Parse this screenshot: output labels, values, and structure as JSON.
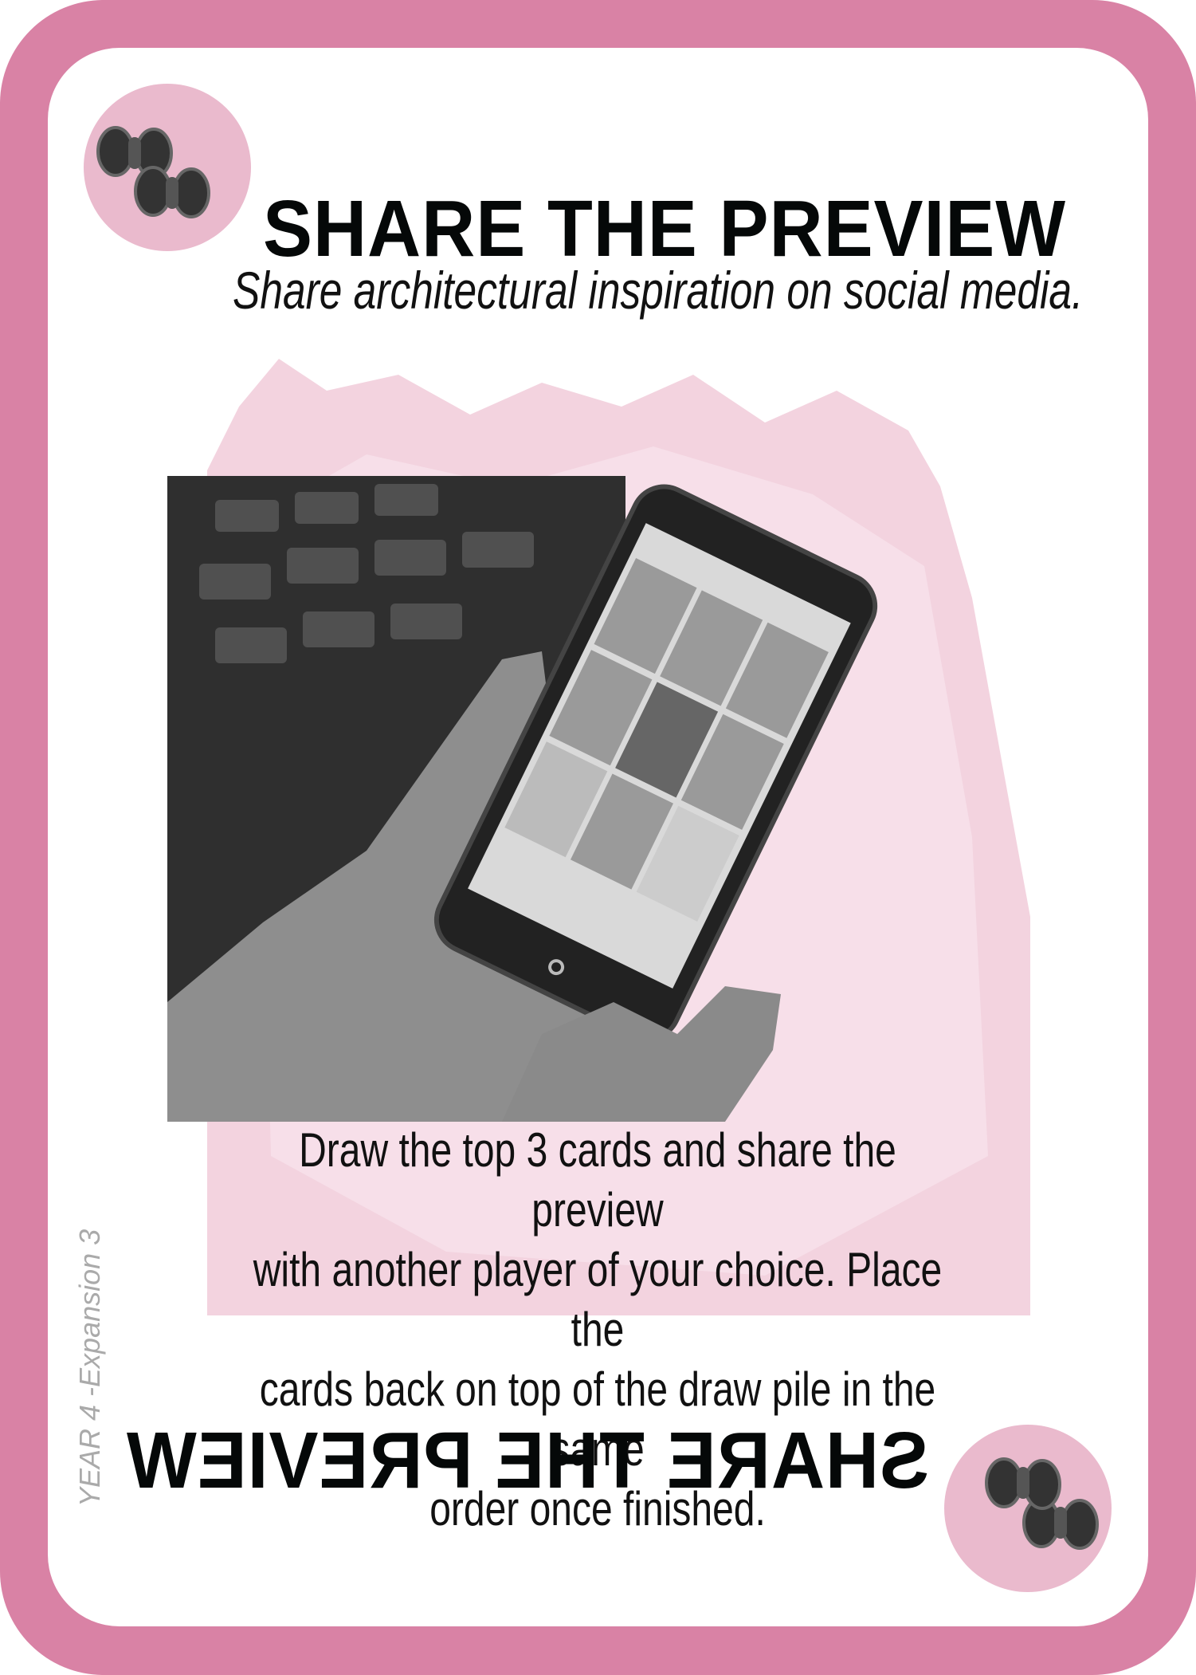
{
  "card": {
    "title": "SHARE THE PREVIEW",
    "subtitle": "Share architectural inspiration on social media.",
    "body_lines": [
      "Draw the top 3 cards and share the preview",
      "with another player of your choice. Place the",
      "cards back on top of the draw pile in the same",
      "order once finished."
    ],
    "mirrored_title": "SHARE THE PREVIEW",
    "edition": "YEAR 4 -Expansion 3",
    "icon": "binoculars-icon",
    "colors": {
      "border": "#d982a5",
      "badge": "#eabacd",
      "splash": "#f3d3df",
      "text": "#050808"
    }
  }
}
